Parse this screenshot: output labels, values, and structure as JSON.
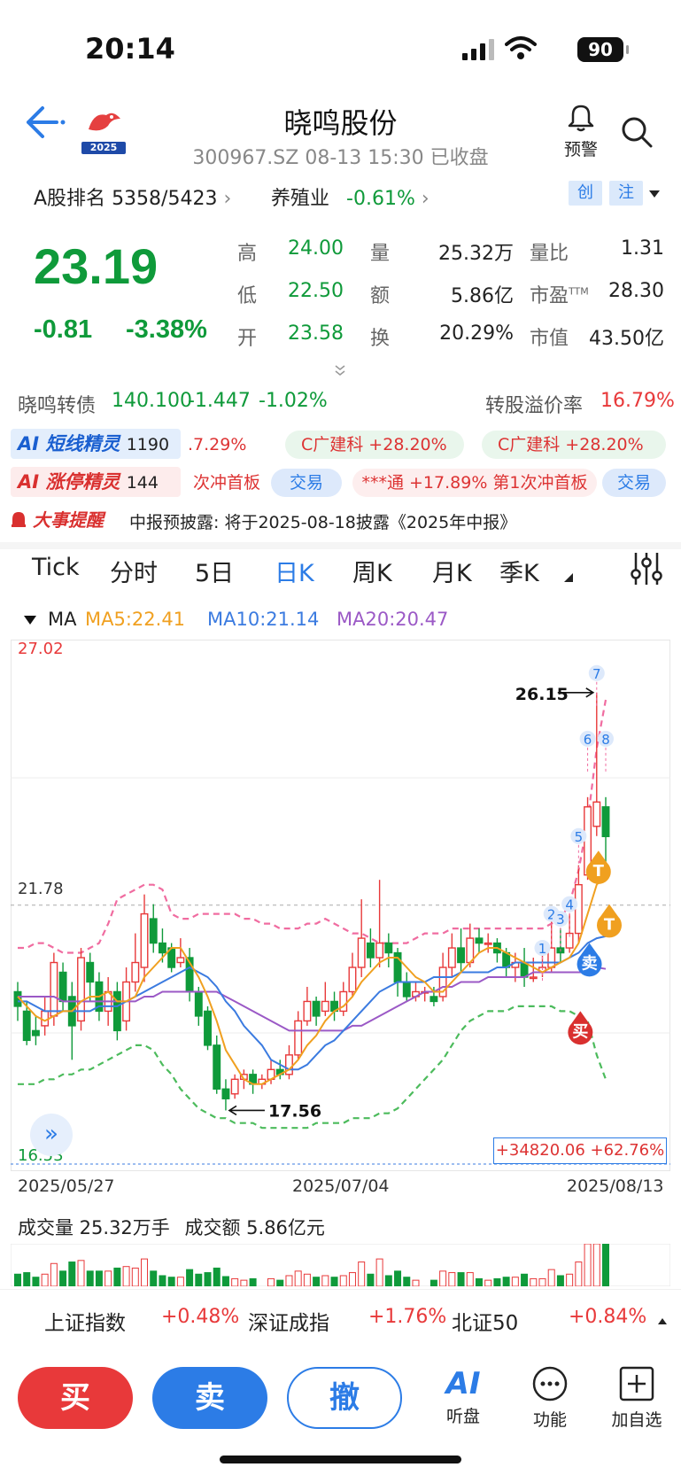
{
  "status_bar": {
    "time": "20:14",
    "battery": "90"
  },
  "header": {
    "title": "晓鸣股份",
    "subtitle": "300967.SZ 08-13 15:30 已收盘",
    "alert_label": "预警",
    "logo_year": "2025"
  },
  "rank_row": {
    "rank_label": "A股排名",
    "rank_value": "5358/5423",
    "industry": "养殖业",
    "industry_change": "-0.61%",
    "tags": [
      "创",
      "注"
    ]
  },
  "quote": {
    "price": "23.19",
    "change": "-0.81",
    "change_pct": "-3.38%",
    "fields": [
      {
        "label": "高",
        "value": "24.00",
        "color": "#0f9a3a"
      },
      {
        "label": "量",
        "value": "25.32万",
        "color": "#222"
      },
      {
        "label": "量比",
        "value": "1.31",
        "color": "#222"
      },
      {
        "label": "低",
        "value": "22.50",
        "color": "#0f9a3a"
      },
      {
        "label": "额",
        "value": "5.86亿",
        "color": "#222"
      },
      {
        "label": "市盈",
        "sup": "TTM",
        "value": "28.30",
        "color": "#222"
      },
      {
        "label": "开",
        "value": "23.58",
        "color": "#0f9a3a"
      },
      {
        "label": "换",
        "value": "20.29%",
        "color": "#222"
      },
      {
        "label": "市值",
        "value": "43.50亿",
        "color": "#222"
      }
    ]
  },
  "bond": {
    "name": "晓鸣转债",
    "price": "140.100",
    "change": "-1.447",
    "change_pct": "-1.02%",
    "premium_label": "转股溢价率",
    "premium_value": "16.79%"
  },
  "ai_rows": [
    {
      "badge": "短线精灵",
      "count": "1190",
      "items": [
        ".7.29%",
        "C广建科 +28.20%",
        "C广建科 +28.20%"
      ]
    },
    {
      "badge": "涨停精灵",
      "count": "144",
      "items": [
        "次冲首板",
        "交易",
        "***通 +17.89% 第1次冲首板",
        "交易"
      ]
    }
  ],
  "event": {
    "badge": "大事提醒",
    "text": "中报预披露: 将于2025-08-18披露《2025年中报》"
  },
  "tabs": [
    "Tick",
    "分时",
    "5日",
    "日K",
    "周K",
    "月K",
    "季K"
  ],
  "active_tab": "日K",
  "ma_legend": {
    "label": "MA",
    "ma5": "MA5:22.41",
    "ma10": "MA10:21.14",
    "ma20": "MA20:20.47",
    "colors": {
      "ma5": "#f0a020",
      "ma10": "#3b7be0",
      "ma20": "#9b59c6"
    }
  },
  "chart_data": {
    "type": "candlestick",
    "y_top_label": "27.02",
    "y_mid_label": "21.78",
    "y_bottom_label": "16.53",
    "ylim": [
      16.53,
      27.02
    ],
    "high_annotation": "26.15",
    "low_annotation": "17.56",
    "profit_box": "+34820.06 +62.76%",
    "x_labels": [
      "2025/05/27",
      "2025/07/04",
      "2025/08/13"
    ],
    "marker_numbers": [
      "1",
      "2",
      "3",
      "4",
      "5",
      "6",
      "7",
      "8"
    ],
    "markers": {
      "buy": "买",
      "sell": "卖",
      "t": "T"
    },
    "candles": [
      [
        20.0,
        19.7,
        20.2,
        19.4
      ],
      [
        19.6,
        19.0,
        19.8,
        18.9
      ],
      [
        19.2,
        19.1,
        19.5,
        18.9
      ],
      [
        19.3,
        19.6,
        19.9,
        19.1
      ],
      [
        19.5,
        20.6,
        20.8,
        19.3
      ],
      [
        20.4,
        19.8,
        20.6,
        19.6
      ],
      [
        19.9,
        19.3,
        20.2,
        18.6
      ],
      [
        19.4,
        20.7,
        20.9,
        19.2
      ],
      [
        20.6,
        20.2,
        20.8,
        19.8
      ],
      [
        20.2,
        19.6,
        20.4,
        19.4
      ],
      [
        19.6,
        20.0,
        20.3,
        19.3
      ],
      [
        20.0,
        19.2,
        20.2,
        19.0
      ],
      [
        19.4,
        20.2,
        20.5,
        19.2
      ],
      [
        20.2,
        20.6,
        21.2,
        20.0
      ],
      [
        20.5,
        21.6,
        22.0,
        20.2
      ],
      [
        21.5,
        21.0,
        21.8,
        20.8
      ],
      [
        21.0,
        20.8,
        21.3,
        20.6
      ],
      [
        20.9,
        20.5,
        21.0,
        20.4
      ],
      [
        20.6,
        20.7,
        21.1,
        20.5
      ],
      [
        20.7,
        20.0,
        20.9,
        19.8
      ],
      [
        20.0,
        19.5,
        20.1,
        19.3
      ],
      [
        19.6,
        18.9,
        19.7,
        18.8
      ],
      [
        18.9,
        18.0,
        19.1,
        17.9
      ],
      [
        18.0,
        17.8,
        18.2,
        17.56
      ],
      [
        17.9,
        18.2,
        18.3,
        17.8
      ],
      [
        18.2,
        18.3,
        18.4,
        18.0
      ],
      [
        18.3,
        18.1,
        18.4,
        17.9
      ],
      [
        18.1,
        18.2,
        18.3,
        18.0
      ],
      [
        18.2,
        18.4,
        18.6,
        18.1
      ],
      [
        18.4,
        18.3,
        18.6,
        18.2
      ],
      [
        18.3,
        18.7,
        18.9,
        18.2
      ],
      [
        18.7,
        19.4,
        19.6,
        18.6
      ],
      [
        19.4,
        19.8,
        20.1,
        19.3
      ],
      [
        19.8,
        19.5,
        19.9,
        19.3
      ],
      [
        19.6,
        19.8,
        20.2,
        19.5
      ],
      [
        19.8,
        19.6,
        20.0,
        19.4
      ],
      [
        19.6,
        20.0,
        20.2,
        19.5
      ],
      [
        20.0,
        20.5,
        20.8,
        19.9
      ],
      [
        20.5,
        21.1,
        21.9,
        20.3
      ],
      [
        21.0,
        20.7,
        21.3,
        20.5
      ],
      [
        20.7,
        21.0,
        22.3,
        20.5
      ],
      [
        21.0,
        20.8,
        21.2,
        20.5
      ],
      [
        20.8,
        20.2,
        20.9,
        19.9
      ],
      [
        20.2,
        19.9,
        20.4,
        19.8
      ],
      [
        19.9,
        20.0,
        20.2,
        19.8
      ],
      [
        20.0,
        20.0,
        20.1,
        19.8
      ],
      [
        19.9,
        19.8,
        20.1,
        19.7
      ],
      [
        19.9,
        20.5,
        20.8,
        19.8
      ],
      [
        20.5,
        20.9,
        21.2,
        20.3
      ],
      [
        20.9,
        20.6,
        21.3,
        20.4
      ],
      [
        20.6,
        21.1,
        21.4,
        20.5
      ],
      [
        21.1,
        21.0,
        21.3,
        20.8
      ],
      [
        21.0,
        21.0,
        21.2,
        20.8
      ],
      [
        21.0,
        20.8,
        21.1,
        20.6
      ],
      [
        20.8,
        20.5,
        20.9,
        20.3
      ],
      [
        20.5,
        20.6,
        20.8,
        20.2
      ],
      [
        20.6,
        20.3,
        20.9,
        20.1
      ],
      [
        20.3,
        20.3,
        20.7,
        20.2
      ],
      [
        20.4,
        20.5,
        20.8,
        20.3
      ],
      [
        20.5,
        20.9,
        21.5,
        20.4
      ],
      [
        20.9,
        20.8,
        21.3,
        20.6
      ],
      [
        20.9,
        21.2,
        21.6,
        20.8
      ],
      [
        21.2,
        22.2,
        22.6,
        21.0
      ],
      [
        22.4,
        23.8,
        24.0,
        22.3
      ],
      [
        23.4,
        23.9,
        26.15,
        23.2
      ],
      [
        23.8,
        23.19,
        24.0,
        22.5
      ]
    ],
    "ma5": [
      19.9,
      19.7,
      19.5,
      19.4,
      19.5,
      19.6,
      19.6,
      19.8,
      19.9,
      19.9,
      20.0,
      19.8,
      19.8,
      19.9,
      20.3,
      20.5,
      20.7,
      20.9,
      20.9,
      20.6,
      20.3,
      19.9,
      19.4,
      18.8,
      18.5,
      18.2,
      18.1,
      18.1,
      18.2,
      18.3,
      18.4,
      18.6,
      18.9,
      19.1,
      19.4,
      19.6,
      19.7,
      19.9,
      20.2,
      20.4,
      20.6,
      20.7,
      20.7,
      20.5,
      20.3,
      20.2,
      20.0,
      20.0,
      20.2,
      20.4,
      20.6,
      20.8,
      20.9,
      20.9,
      20.8,
      20.7,
      20.6,
      20.5,
      20.4,
      20.5,
      20.6,
      20.7,
      21.0,
      21.6,
      22.2,
      22.41
    ],
    "ma10": [
      19.8,
      19.8,
      19.7,
      19.6,
      19.6,
      19.6,
      19.6,
      19.6,
      19.6,
      19.7,
      19.7,
      19.7,
      19.8,
      19.9,
      20.0,
      20.1,
      20.2,
      20.3,
      20.4,
      20.5,
      20.4,
      20.3,
      20.1,
      19.8,
      19.6,
      19.3,
      19.1,
      18.9,
      18.6,
      18.5,
      18.4,
      18.4,
      18.5,
      18.7,
      18.9,
      19.0,
      19.2,
      19.4,
      19.6,
      19.8,
      20.0,
      20.1,
      20.2,
      20.2,
      20.2,
      20.2,
      20.3,
      20.3,
      20.3,
      20.4,
      20.4,
      20.4,
      20.4,
      20.5,
      20.5,
      20.6,
      20.6,
      20.6,
      20.6,
      20.6,
      20.6,
      20.7,
      20.8,
      21.0,
      21.1,
      21.14
    ],
    "ma20": [
      19.9,
      19.9,
      19.9,
      19.9,
      19.9,
      19.8,
      19.8,
      19.8,
      19.8,
      19.8,
      19.8,
      19.8,
      19.8,
      19.8,
      19.9,
      19.9,
      20.0,
      20.0,
      20.0,
      20.0,
      20.0,
      20.0,
      20.0,
      19.9,
      19.8,
      19.7,
      19.6,
      19.5,
      19.4,
      19.3,
      19.2,
      19.2,
      19.2,
      19.2,
      19.2,
      19.2,
      19.2,
      19.3,
      19.3,
      19.4,
      19.5,
      19.6,
      19.7,
      19.8,
      19.9,
      20.0,
      20.0,
      20.1,
      20.1,
      20.2,
      20.2,
      20.2,
      20.3,
      20.3,
      20.3,
      20.3,
      20.3,
      20.4,
      20.4,
      20.4,
      20.4,
      20.4,
      20.4,
      20.4,
      20.5,
      20.47
    ],
    "boll_upper": [
      20.9,
      20.9,
      21.0,
      21.0,
      20.9,
      20.8,
      20.8,
      20.8,
      20.9,
      21.0,
      21.4,
      21.9,
      22.0,
      22.1,
      22.2,
      22.2,
      22.1,
      21.6,
      21.5,
      21.5,
      21.6,
      21.6,
      21.6,
      21.6,
      21.6,
      21.5,
      21.5,
      21.4,
      21.4,
      21.3,
      21.3,
      21.3,
      21.4,
      21.4,
      21.5,
      21.4,
      21.3,
      21.2,
      21.2,
      21.1,
      21.0,
      21.0,
      21.0,
      21.0,
      21.1,
      21.2,
      21.2,
      21.2,
      21.3,
      21.3,
      21.3,
      21.3,
      21.3,
      21.3,
      21.3,
      21.3,
      21.3,
      21.3,
      21.3,
      21.4,
      21.5,
      21.8,
      22.5,
      23.5,
      25.0,
      26.0
    ],
    "boll_lower": [
      18.1,
      18.1,
      18.1,
      18.2,
      18.2,
      18.3,
      18.3,
      18.4,
      18.4,
      18.5,
      18.6,
      18.7,
      18.8,
      18.9,
      18.9,
      18.8,
      18.5,
      18.3,
      18.0,
      17.8,
      17.6,
      17.5,
      17.4,
      17.4,
      17.3,
      17.3,
      17.3,
      17.2,
      17.2,
      17.2,
      17.2,
      17.2,
      17.2,
      17.3,
      17.3,
      17.3,
      17.3,
      17.4,
      17.4,
      17.4,
      17.5,
      17.5,
      17.6,
      17.8,
      18.0,
      18.2,
      18.4,
      18.6,
      18.9,
      19.2,
      19.4,
      19.5,
      19.6,
      19.6,
      19.6,
      19.7,
      19.7,
      19.7,
      19.7,
      19.7,
      19.6,
      19.6,
      19.5,
      19.4,
      18.7,
      18.2
    ]
  },
  "volume_label": {
    "vol": "成交量 25.32万手",
    "amt": "成交额 5.86亿元"
  },
  "indices": [
    {
      "name": "上证指数",
      "change": "+0.48%"
    },
    {
      "name": "深证成指",
      "change": "+1.76%"
    },
    {
      "name": "北证50",
      "change": "+0.84%"
    }
  ],
  "actions": {
    "buy": "买",
    "sell": "卖",
    "cancel": "撤"
  },
  "tools": [
    {
      "label": "听盘",
      "icon": "ai-icon"
    },
    {
      "label": "功能",
      "icon": "more-icon"
    },
    {
      "label": "加自选",
      "icon": "add-watchlist-icon"
    }
  ]
}
